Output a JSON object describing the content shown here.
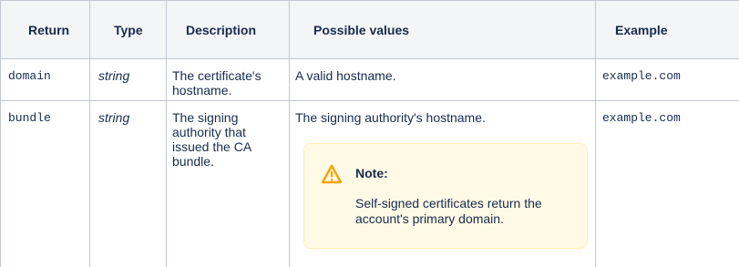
{
  "table": {
    "headers": [
      "Return",
      "Type",
      "Description",
      "Possible values",
      "Example"
    ],
    "rows": [
      {
        "return": "domain",
        "type": "string",
        "description": "The certificate's hostname.",
        "possible_values": "A valid hostname.",
        "example": "example.com"
      },
      {
        "return": "bundle",
        "type": "string",
        "description": "The signing authority that issued the CA bundle.",
        "possible_values": "The signing authority's hostname.",
        "example": "example.com",
        "note": {
          "icon": "warning-icon",
          "title": "Note:",
          "body": "Self-signed certificates return the account's primary domain."
        }
      }
    ]
  },
  "colors": {
    "header_bg": "#f4f5f7",
    "grid": "#c1c7d0",
    "note_bg": "#fffae6",
    "note_border": "#fff0b3",
    "warning_icon": "#f5a300"
  }
}
